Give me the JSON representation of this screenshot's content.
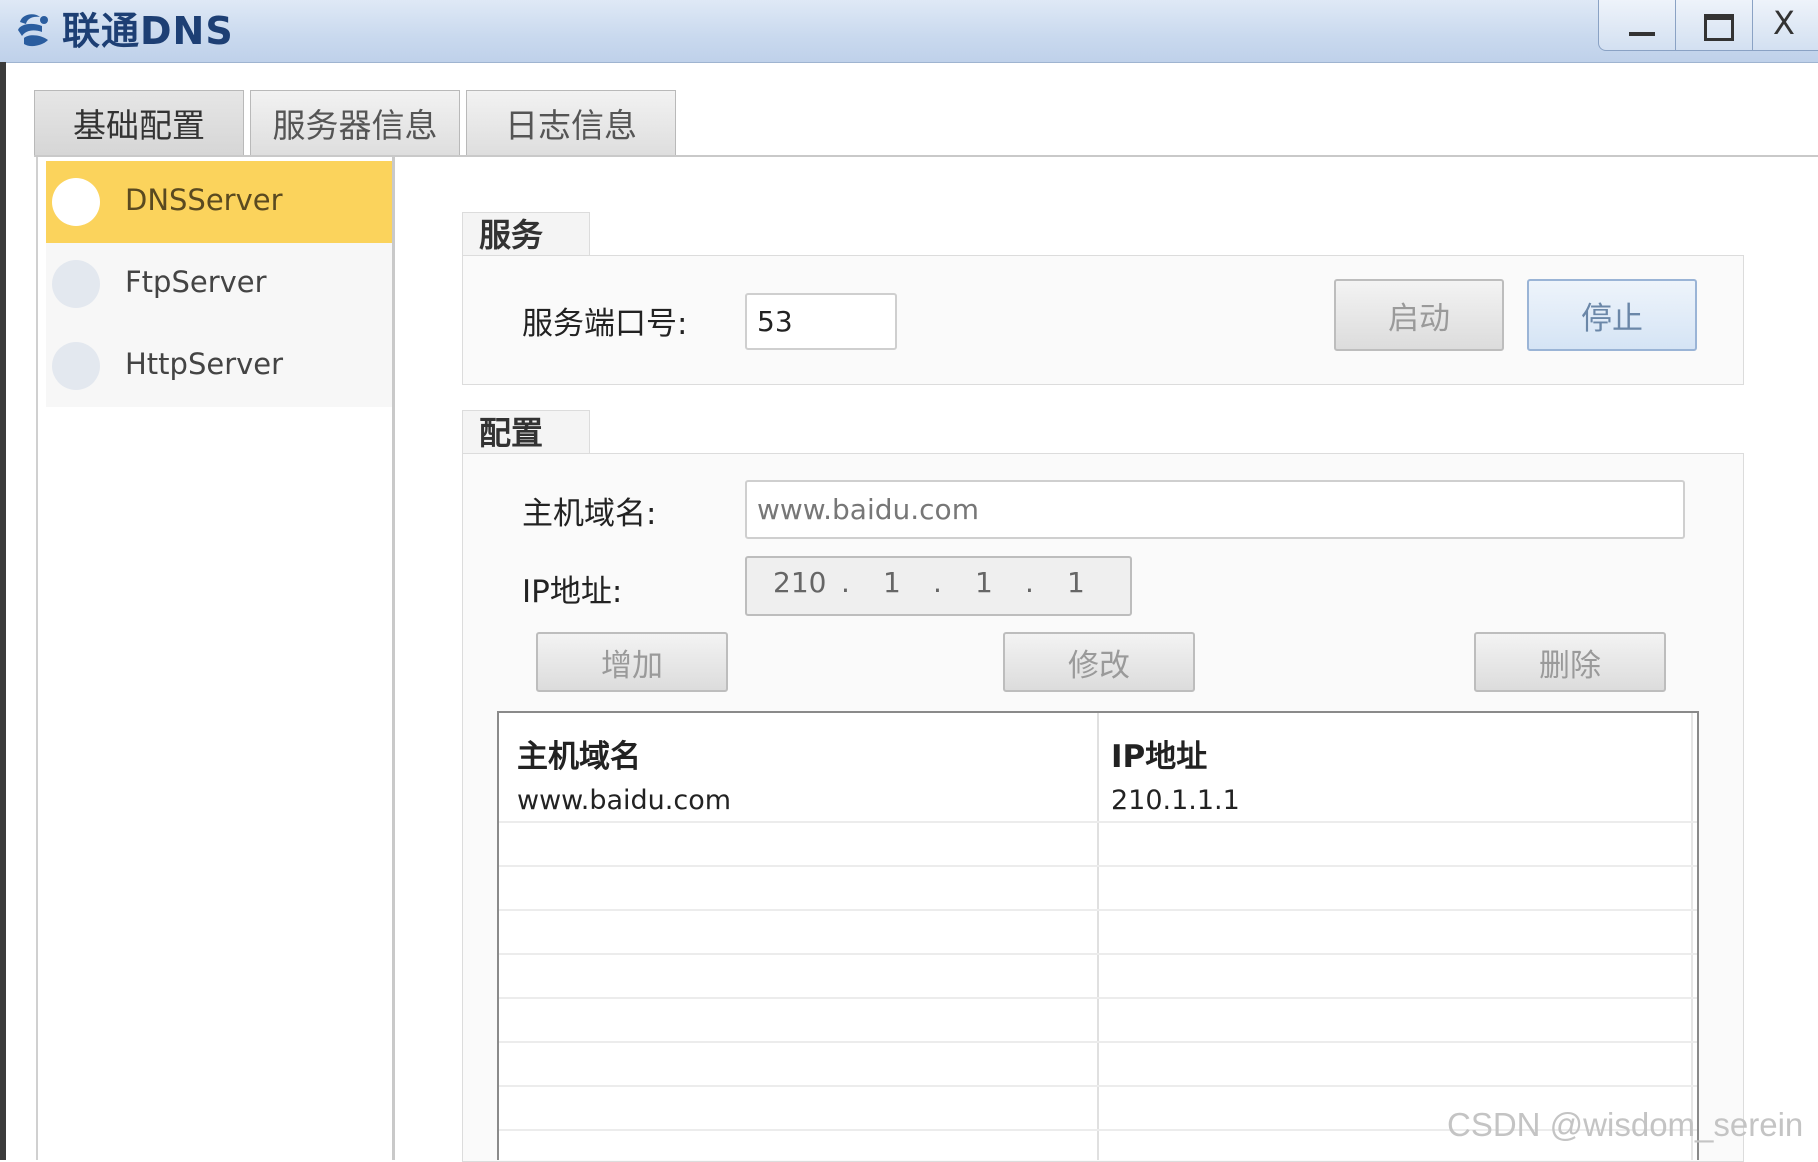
{
  "window": {
    "title": "联通DNS",
    "close_label": "X"
  },
  "tabs": [
    {
      "label": "基础配置"
    },
    {
      "label": "服务器信息"
    },
    {
      "label": "日志信息"
    }
  ],
  "nav": {
    "items": [
      {
        "label": "DNSServer",
        "selected": true
      },
      {
        "label": "FtpServer",
        "selected": false
      },
      {
        "label": "HttpServer",
        "selected": false
      }
    ]
  },
  "service_group": {
    "title": "服务",
    "port_label": "服务端口号:",
    "port_value": "53",
    "start_label": "启动",
    "stop_label": "停止"
  },
  "config_group": {
    "title": "配置",
    "host_label": "主机域名:",
    "host_value": "www.baidu.com",
    "ip_label": "IP地址:",
    "ip_parts": [
      "210",
      "1",
      "1",
      "1"
    ],
    "add_label": "增加",
    "modify_label": "修改",
    "delete_label": "删除"
  },
  "table": {
    "headers": [
      "主机域名",
      "IP地址"
    ],
    "rows": [
      [
        "www.baidu.com",
        "210.1.1.1"
      ]
    ]
  },
  "watermark": "CSDN @wisdom_serein",
  "colors": {
    "selected_nav": "#fbd35c",
    "titlebar": "#c9d9ee"
  }
}
